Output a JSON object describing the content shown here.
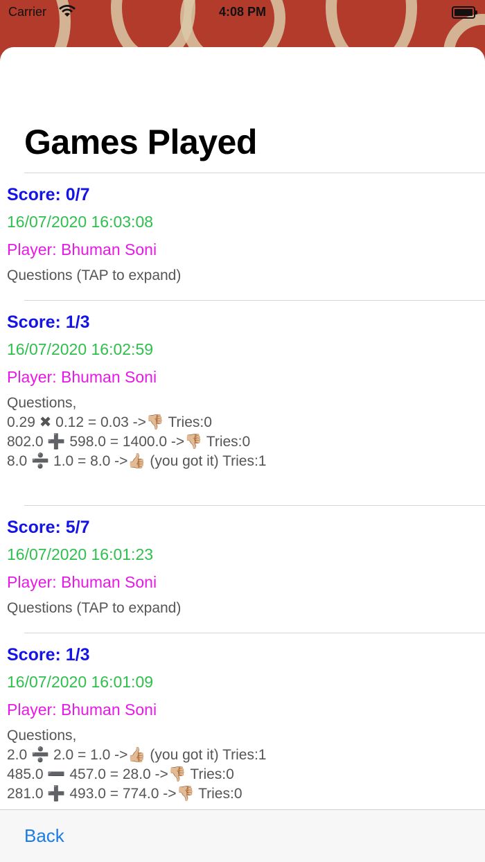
{
  "status_bar": {
    "carrier": "Carrier",
    "time": "4:08 PM"
  },
  "page": {
    "title": "Games Played"
  },
  "games": [
    {
      "score": "Score: 0/7",
      "date": "16/07/2020 16:03:08",
      "player": "Player: Bhuman Soni",
      "questions_label": "Questions (TAP to expand)",
      "questions": []
    },
    {
      "score": "Score: 1/3",
      "date": "16/07/2020 16:02:59",
      "player": "Player: Bhuman Soni",
      "questions_label": "Questions,",
      "questions": [
        "0.29 ✖ 0.12 = 0.03 ->👎🏼 Tries:0",
        "802.0 ➕ 598.0 = 1400.0 ->👎🏼 Tries:0",
        "8.0 ➗ 1.0 = 8.0 ->👍🏼 (you got it) Tries:1"
      ]
    },
    {
      "score": "Score: 5/7",
      "date": "16/07/2020 16:01:23",
      "player": "Player: Bhuman Soni",
      "questions_label": "Questions (TAP to expand)",
      "questions": []
    },
    {
      "score": "Score: 1/3",
      "date": "16/07/2020 16:01:09",
      "player": "Player: Bhuman Soni",
      "questions_label": "Questions,",
      "questions": [
        "2.0 ➗ 2.0 = 1.0 ->👍🏼 (you got it) Tries:1",
        "485.0 ➖ 457.0 = 28.0 ->👎🏼 Tries:0",
        "281.0 ➕ 493.0 = 774.0 ->👎🏼 Tries:0"
      ]
    }
  ],
  "toolbar": {
    "back_label": "Back"
  },
  "colors": {
    "score": "#1414e6",
    "date": "#2fbf4d",
    "player": "#e619e6",
    "link": "#1b7ce4"
  }
}
